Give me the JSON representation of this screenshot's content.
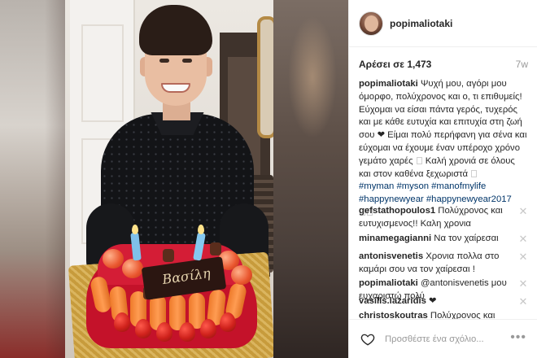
{
  "post": {
    "username": "popimaliotaki",
    "likes_label": "Αρέσει σε 1,473",
    "age": "7w",
    "photo_cake_text": "Βασίλη"
  },
  "caption": {
    "username": "popimaliotaki",
    "text": "Ψυχή μου, αγόρι μου όμορφο, πολύχρονος και ο, τι επιθυμείς! Εύχομαι να είσαι πάντα γερός, τυχερός και με κάθε ευτυχία και επιτυχία στη ζωή σου ❤ Είμαι πολύ περήφανη για σένα και εύχομαι να έχουμε έναν υπέροχο χρόνο γεμάτο χαρές",
    "text2": "Καλή χρονιά σε όλους και στον καθένα ξεχωριστά",
    "hashtags": "#myman #myson #manofmylife #happynewyear #happynewyear2017"
  },
  "comments": [
    {
      "username": "gefstathopoulos1",
      "text": "Πολύχρονος και ευτυχισμενος!! Καλη χρονια"
    },
    {
      "username": "minamegagianni",
      "text": "Να τον χαίρεσαι"
    },
    {
      "username": "antonisvenetis",
      "text": "Χρονια πολλα στο καμάρι σου να τον χαίρεσαι !"
    },
    {
      "username": "popimaliotaki",
      "text": "@antonisvenetis μου ευχαριστώ πολύ"
    },
    {
      "username": "vasilis.lazaridis",
      "text": "❤"
    },
    {
      "username": "christoskoutras",
      "text": "Πολύχρονος και"
    }
  ],
  "add_comment": {
    "placeholder": "Προσθέστε ένα σχόλιο...",
    "more_label": "•••"
  },
  "icons": {
    "heart": "heart-outline-icon",
    "close": "close-icon",
    "more": "more-options-icon"
  },
  "colors": {
    "hashtag": "#003569",
    "muted": "#999999",
    "text": "#262626"
  }
}
